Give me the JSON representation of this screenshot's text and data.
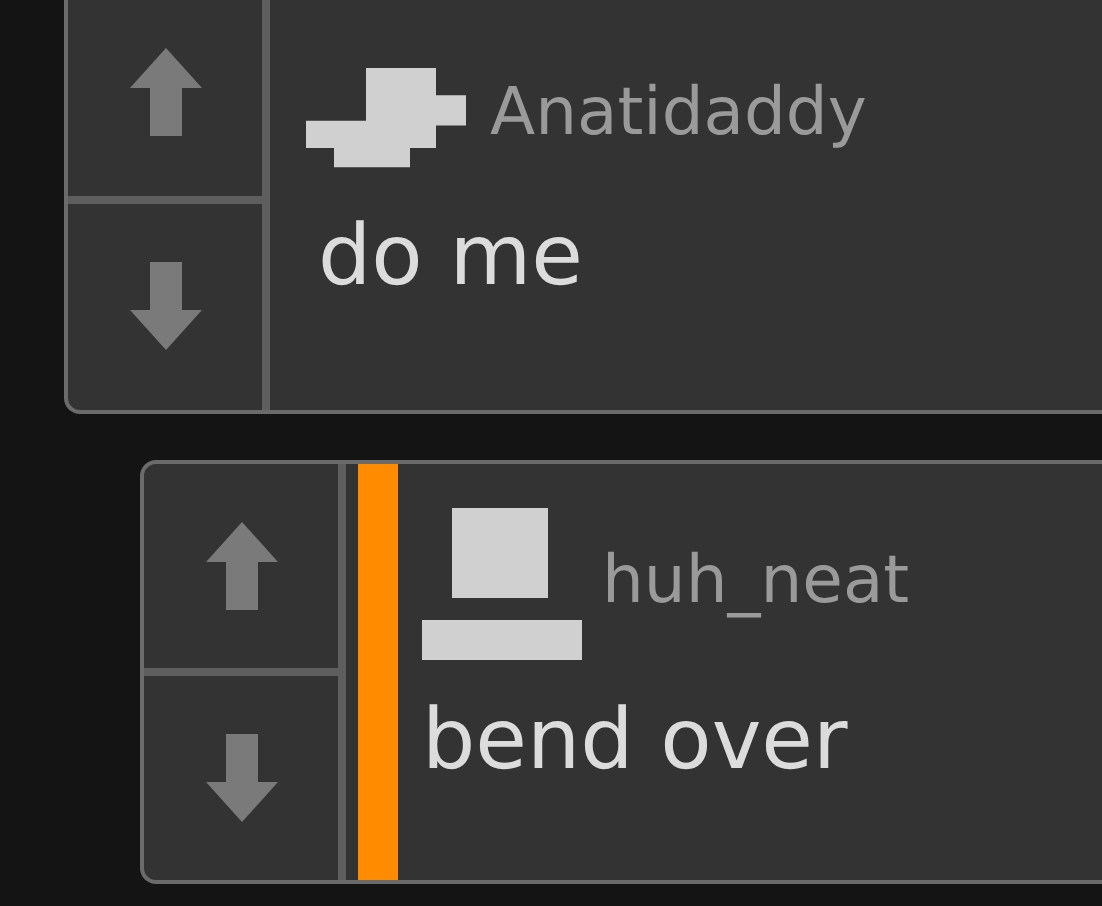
{
  "comments": [
    {
      "username": "Anatidaddy",
      "body": "do me",
      "highlighted": false
    },
    {
      "username": "huh_neat",
      "body": "bend over",
      "highlighted": true
    }
  ]
}
